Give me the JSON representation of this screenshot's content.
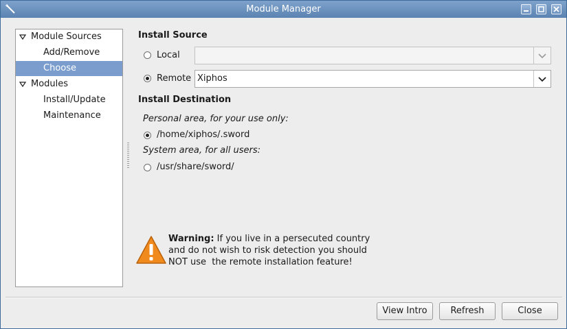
{
  "window": {
    "title": "Module Manager",
    "icon": "wand-icon"
  },
  "sidebar": {
    "items": [
      {
        "label": "Module Sources",
        "level": 0,
        "expanded": true
      },
      {
        "label": "Add/Remove",
        "level": 1
      },
      {
        "label": "Choose",
        "level": 1,
        "selected": true
      },
      {
        "label": "Modules",
        "level": 0,
        "expanded": true
      },
      {
        "label": "Install/Update",
        "level": 1
      },
      {
        "label": "Maintenance",
        "level": 1
      }
    ]
  },
  "install_source": {
    "heading": "Install Source",
    "local_label": "Local",
    "local_value": "",
    "remote_label": "Remote",
    "remote_value": "Xiphos",
    "selected": "remote"
  },
  "install_destination": {
    "heading": "Install Destination",
    "personal_caption": "Personal area, for your use only:",
    "personal_path": "/home/xiphos/.sword",
    "system_caption": "System area, for all users:",
    "system_path": "/usr/share/sword/",
    "selected": "personal"
  },
  "warning": {
    "bold": "Warning:",
    "line1": " If you live in a persecuted country",
    "line2": "and do not wish to risk detection you should",
    "line3": "NOT use  the remote installation feature!"
  },
  "buttons": {
    "view_intro": "View Intro",
    "refresh": "Refresh",
    "close": "Close"
  },
  "colors": {
    "titlebar": "#6a91bf",
    "selection": "#7a9dcd",
    "warning": "#f08a1c"
  }
}
